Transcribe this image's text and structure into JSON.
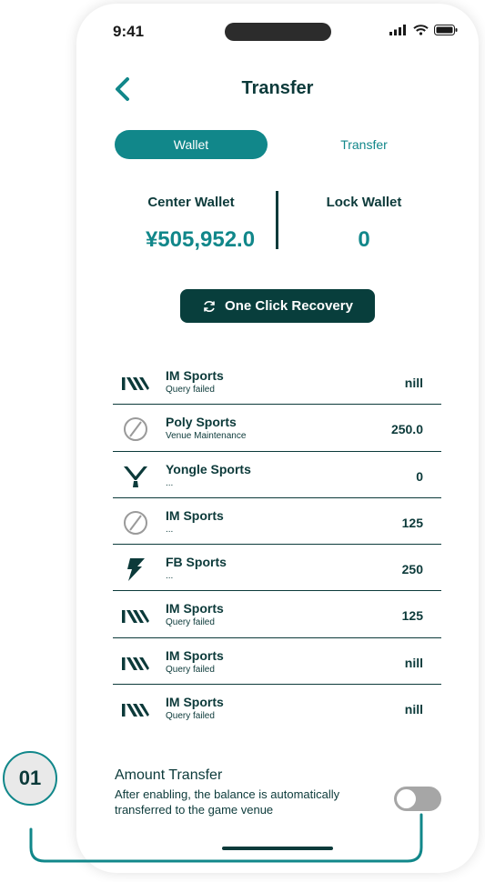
{
  "status_bar": {
    "time": "9:41"
  },
  "header": {
    "title": "Transfer"
  },
  "tabs": [
    {
      "label": "Wallet",
      "active": true
    },
    {
      "label": "Transfer",
      "active": false
    }
  ],
  "wallets": {
    "center": {
      "label": "Center Wallet",
      "value": "¥505,952.0"
    },
    "lock": {
      "label": "Lock Wallet",
      "value": "0"
    }
  },
  "recovery_button": {
    "label": "One Click Recovery",
    "icon": "refresh-icon"
  },
  "venues": [
    {
      "name": "IM Sports",
      "status": "Query failed",
      "amount": "nill",
      "icon": "im-logo-icon"
    },
    {
      "name": "Poly Sports",
      "status": "Venue Maintenance",
      "amount": "250.0",
      "icon": "maintenance-icon"
    },
    {
      "name": "Yongle Sports",
      "status": "...",
      "amount": "0",
      "icon": "yongle-logo-icon"
    },
    {
      "name": "IM Sports",
      "status": "...",
      "amount": "125",
      "icon": "maintenance-icon"
    },
    {
      "name": "FB Sports",
      "status": "...",
      "amount": "250",
      "icon": "fb-logo-icon"
    },
    {
      "name": "IM Sports",
      "status": "Query failed",
      "amount": "125",
      "icon": "im-logo-icon"
    },
    {
      "name": "IM Sports",
      "status": "Query failed",
      "amount": "nill",
      "icon": "im-logo-icon"
    },
    {
      "name": "IM Sports",
      "status": "Query failed",
      "amount": "nill",
      "icon": "im-logo-icon"
    }
  ],
  "amount_transfer": {
    "title": "Amount Transfer",
    "description": "After enabling, the balance is automatically transferred to the game venue",
    "enabled": false
  },
  "callout": {
    "label": "01"
  },
  "colors": {
    "accent": "#11878a",
    "dark": "#083e3c",
    "text": "#0c3a3a",
    "toggle_off": "#a6a6a6"
  }
}
